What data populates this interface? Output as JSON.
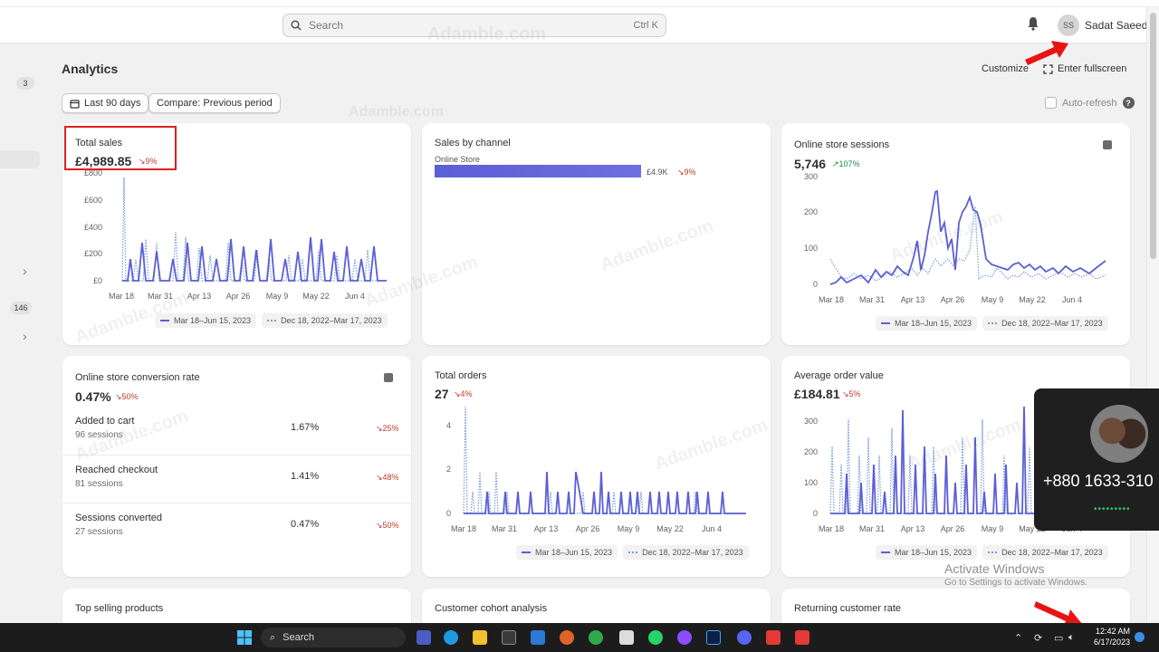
{
  "topbar": {
    "search_placeholder": "Search",
    "search_shortcut": "Ctrl K",
    "avatar_initials": "SS",
    "user_name": "Sadat Saeed"
  },
  "rail": {
    "badge_top": "3",
    "badge_mid": "146"
  },
  "header": {
    "title": "Analytics",
    "customize": "Customize",
    "fullscreen": "Enter fullscreen",
    "date_range": "Last 90 days",
    "compare": "Compare: Previous period",
    "auto_refresh": "Auto-refresh"
  },
  "watermark": "Adamble.com",
  "legend": {
    "current": "Mar 18–Jun 15, 2023",
    "previous": "Dec 18, 2022–Mar 17, 2023"
  },
  "x_ticks": [
    "Mar 18",
    "Mar 31",
    "Apr 13",
    "Apr 26",
    "May 9",
    "May 22",
    "Jun 4"
  ],
  "cards": {
    "total_sales": {
      "title": "Total sales",
      "value": "£4,989.85",
      "delta": "9%",
      "y_ticks": [
        "£800",
        "£600",
        "£400",
        "£200",
        "£0"
      ]
    },
    "sales_by_channel": {
      "title": "Sales by channel",
      "channel": "Online Store",
      "amount": "£4.9K",
      "delta": "9%",
      "fill": 1.0
    },
    "sessions": {
      "title": "Online store sessions",
      "value": "5,746",
      "delta": "107%",
      "y_ticks": [
        "300",
        "200",
        "100",
        "0"
      ]
    },
    "conversion": {
      "title": "Online store conversion rate",
      "value": "0.47%",
      "delta": "50%",
      "rows": [
        {
          "label": "Added to cart",
          "sub": "96 sessions",
          "pct": "1.67%",
          "chg": "25%"
        },
        {
          "label": "Reached checkout",
          "sub": "81 sessions",
          "pct": "1.41%",
          "chg": "48%"
        },
        {
          "label": "Sessions converted",
          "sub": "27 sessions",
          "pct": "0.47%",
          "chg": "50%"
        }
      ]
    },
    "orders": {
      "title": "Total orders",
      "value": "27",
      "delta": "4%",
      "y_ticks": [
        "4",
        "2",
        "0"
      ]
    },
    "aov": {
      "title": "Average order value",
      "value": "£184.81",
      "delta": "5%",
      "y_ticks": [
        "300",
        "200",
        "100",
        "0"
      ]
    },
    "top_products": {
      "title": "Top selling products"
    },
    "cohort": {
      "title": "Customer cohort analysis"
    },
    "returning": {
      "title": "Returning customer rate"
    }
  },
  "popup": {
    "phone": "+880 1633-310"
  },
  "activate": {
    "line1": "Activate Windows",
    "line2": "Go to Settings to activate Windows."
  },
  "taskbar": {
    "search": "Search",
    "clock_time": "12:42 AM",
    "clock_date": "6/17/2023"
  },
  "colors": {
    "accent": "#5b5fd6",
    "previous": "#7a9bd6",
    "up": "#1a8a4a",
    "down": "#c0392b",
    "highlight": "#e02020"
  }
}
